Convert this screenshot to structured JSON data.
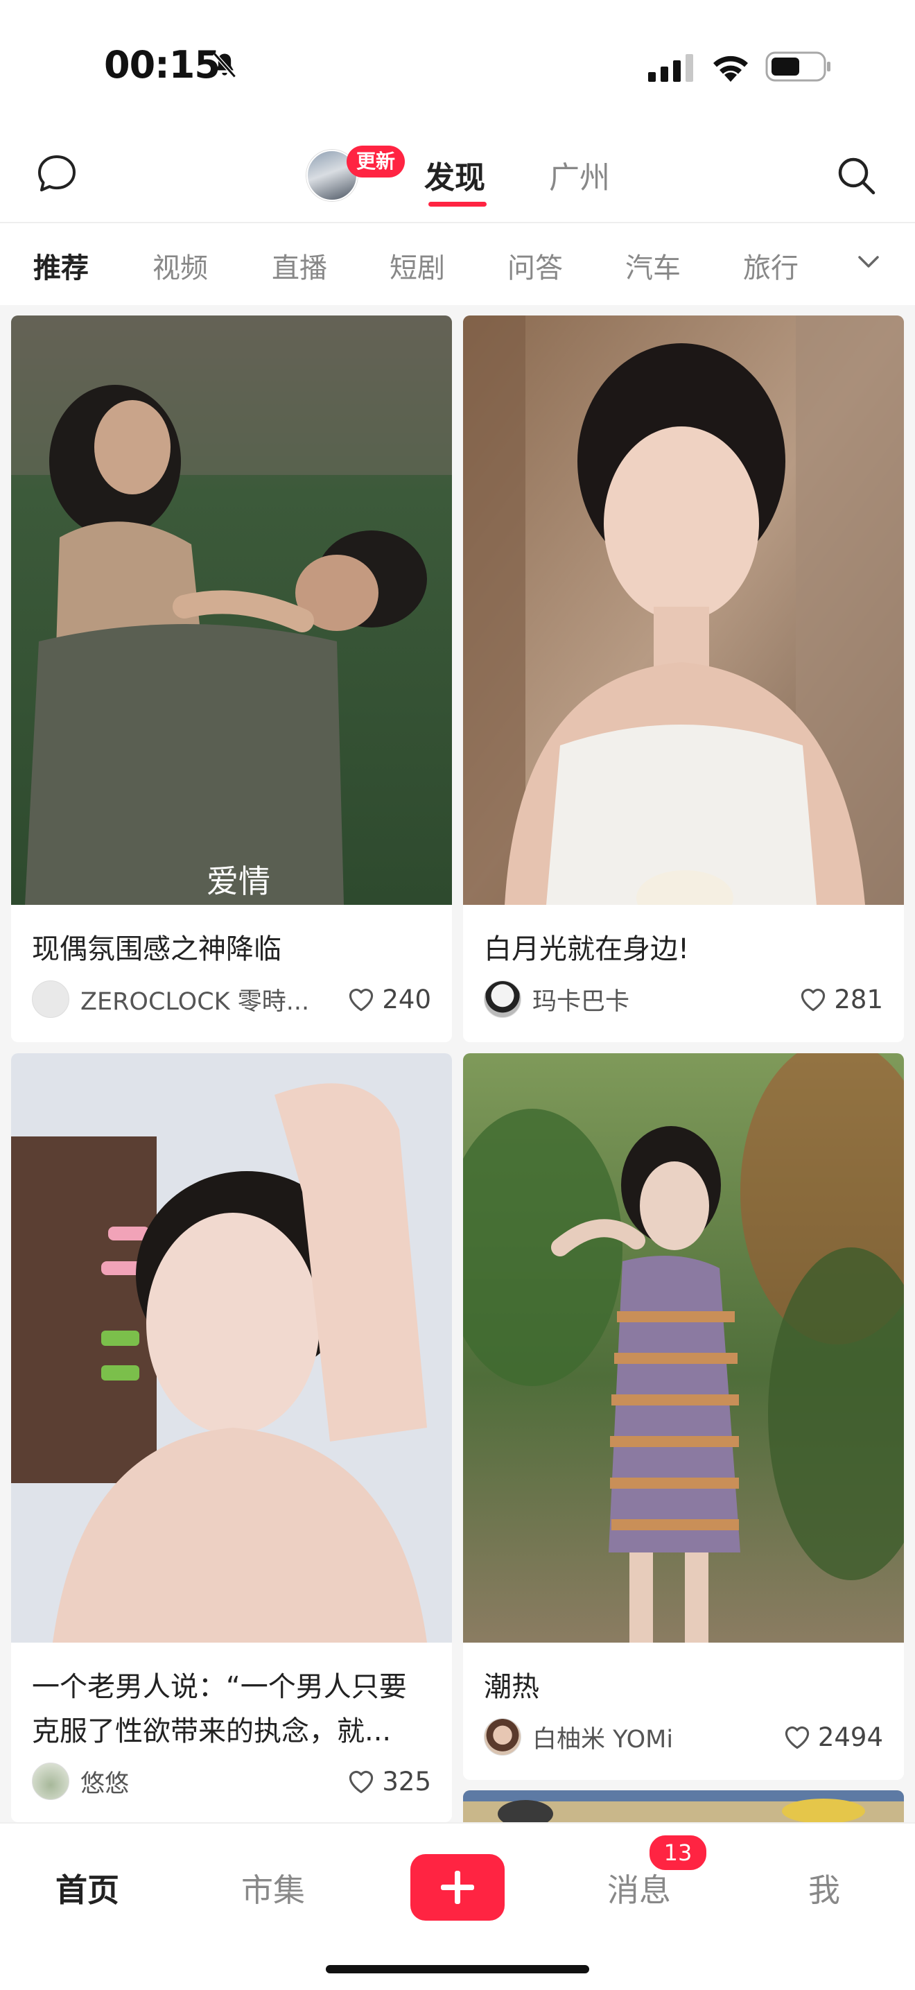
{
  "status_bar": {
    "time": "00:15"
  },
  "top_nav": {
    "update_badge": "更新",
    "tabs": [
      {
        "label": "发现",
        "active": true
      },
      {
        "label": "广州",
        "active": false
      }
    ]
  },
  "categories": {
    "items": [
      "推荐",
      "视频",
      "直播",
      "短剧",
      "问答",
      "汽车",
      "旅行"
    ],
    "active_index": 0
  },
  "feed": {
    "cards": [
      {
        "title": "现偶氛围感之神降临",
        "author": "ZEROCLOCK 零時...",
        "likes": "240",
        "image_overlay": "爱情"
      },
      {
        "title": "白月光就在身边!",
        "author": "玛卡巴卡",
        "likes": "281"
      },
      {
        "title_lines": [
          "一个老男人说：“一个男人只要",
          "克服了性欲带来的执念，就..."
        ],
        "author": "悠悠",
        "likes": "325"
      },
      {
        "title": "潮热",
        "author": "白柚米 YOMi",
        "likes": "2494"
      }
    ]
  },
  "bottom_tabs": {
    "items": [
      "首页",
      "市集",
      "消息",
      "我"
    ],
    "active": "首页",
    "messages_badge": "13"
  },
  "colors": {
    "accent": "#ff2442",
    "background": "#f5f5f5",
    "card": "#ffffff"
  }
}
